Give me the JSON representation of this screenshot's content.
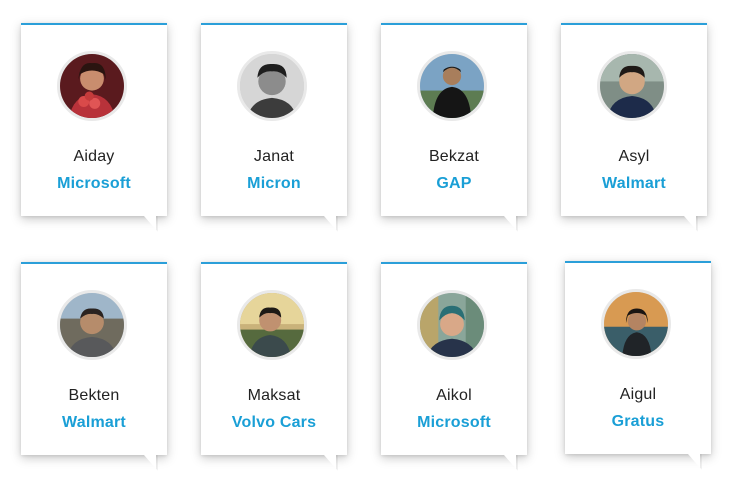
{
  "colors": {
    "accent": "#1a9fd6",
    "top_border": "#2b9fd9"
  },
  "cards": [
    {
      "name": "Aiday",
      "company": "Microsoft"
    },
    {
      "name": "Janat",
      "company": "Micron"
    },
    {
      "name": "Bekzat",
      "company": "GAP"
    },
    {
      "name": "Asyl",
      "company": "Walmart"
    },
    {
      "name": "Bekten",
      "company": "Walmart"
    },
    {
      "name": "Maksat",
      "company": "Volvo Cars"
    },
    {
      "name": "Aikol",
      "company": "Microsoft"
    },
    {
      "name": "Aigul",
      "company": "Gratus"
    }
  ]
}
